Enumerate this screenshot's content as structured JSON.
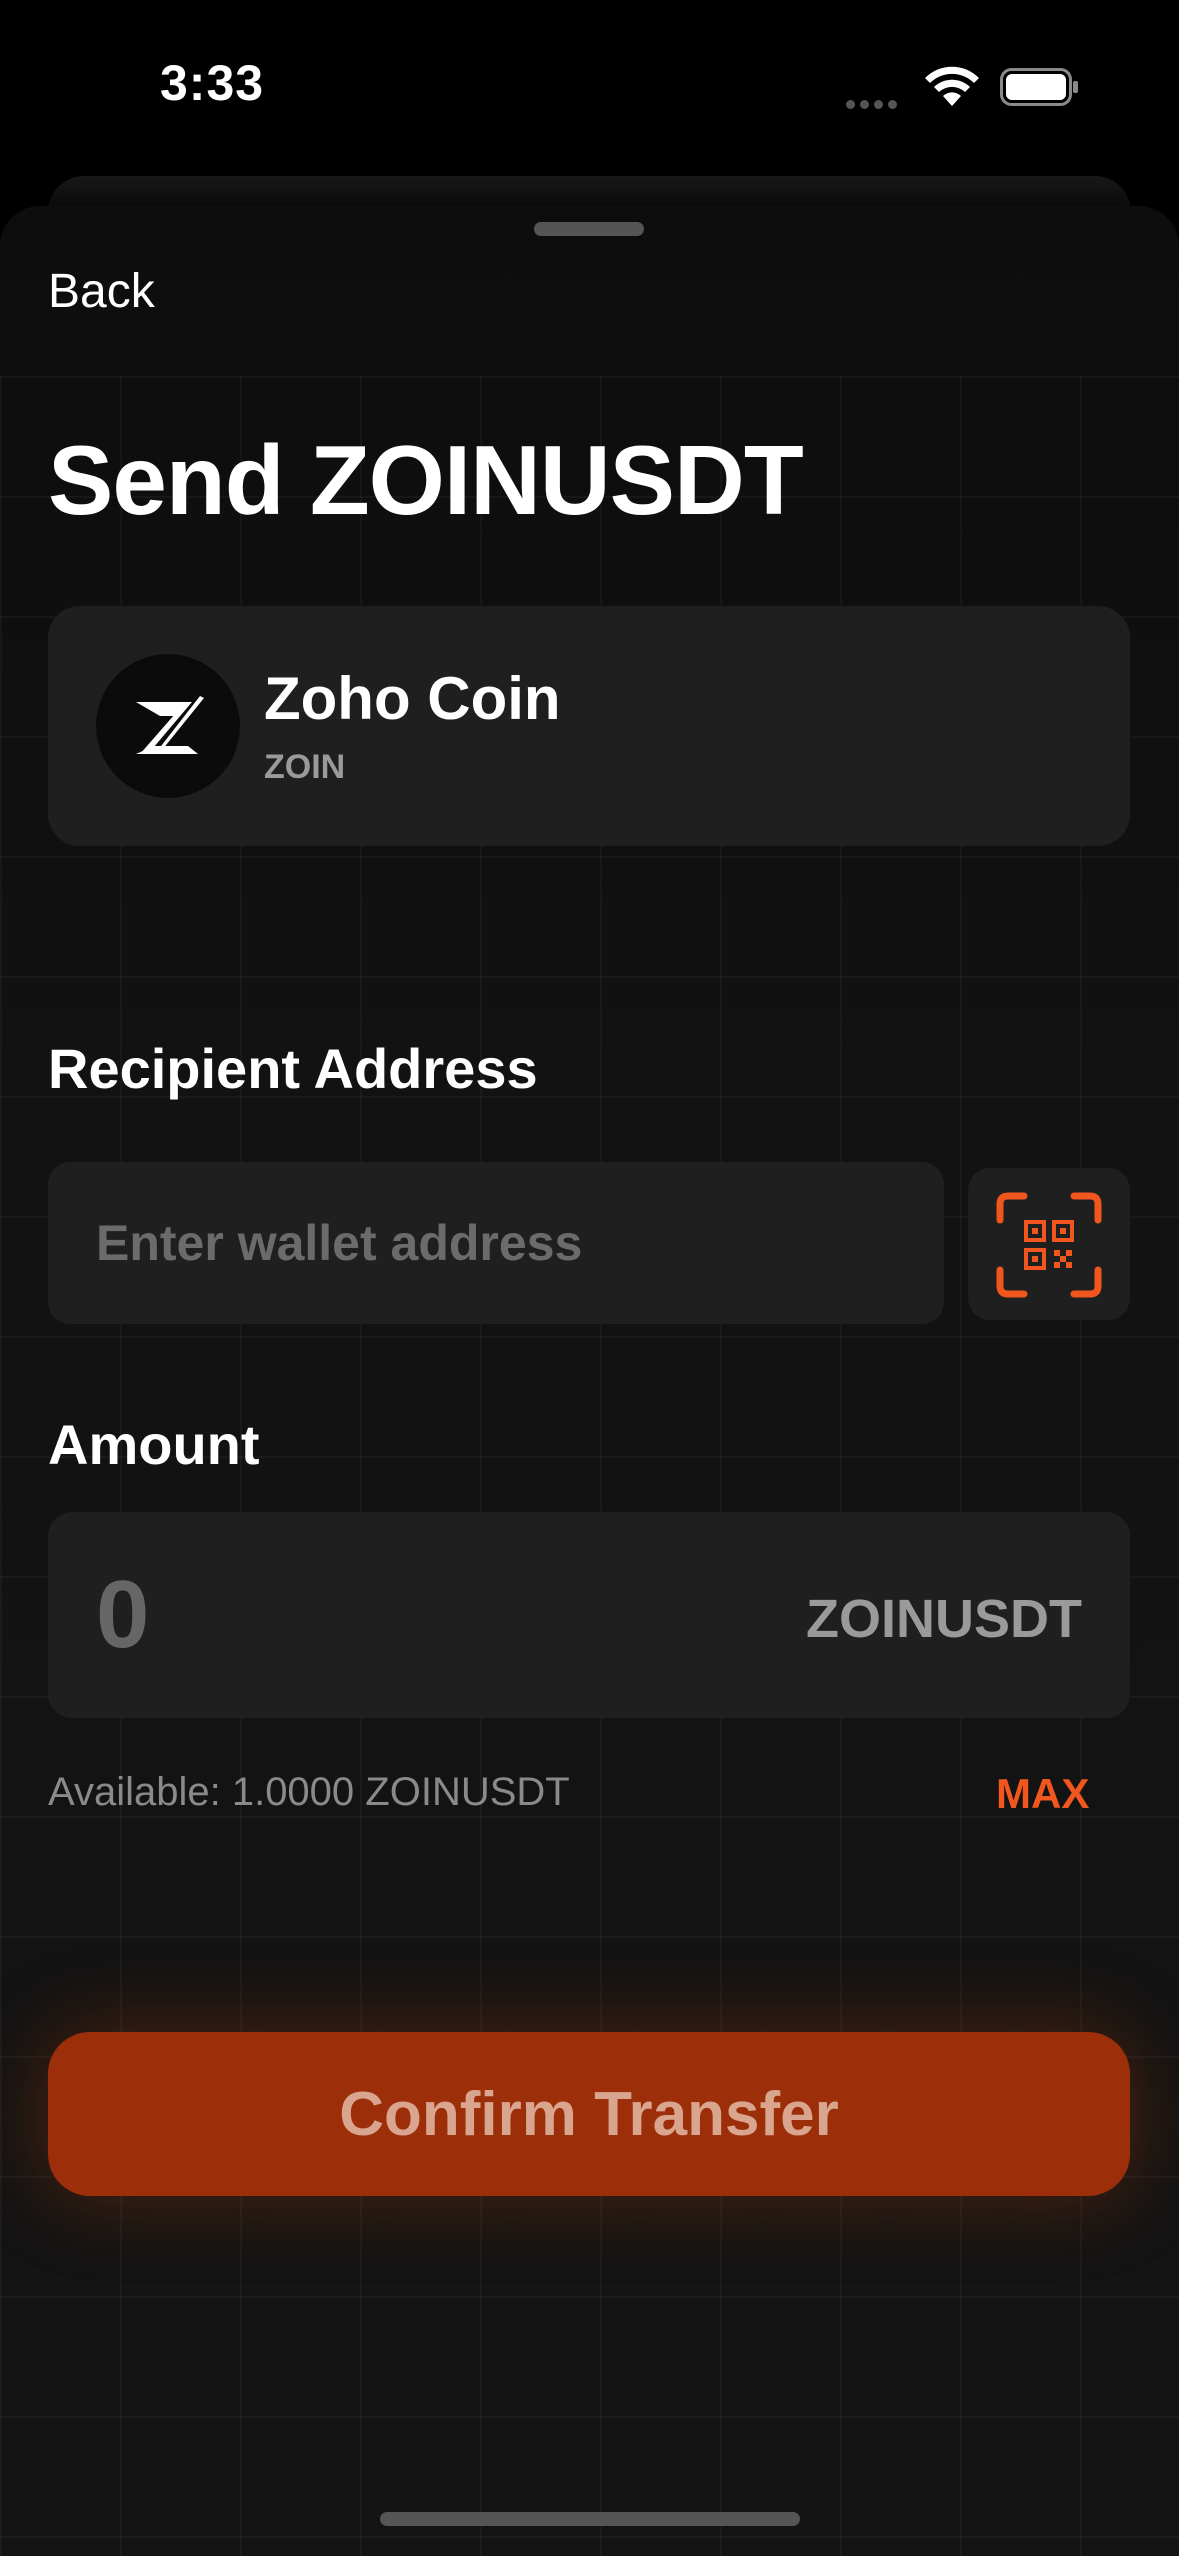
{
  "status_bar": {
    "time": "3:33"
  },
  "nav": {
    "back_label": "Back"
  },
  "page": {
    "title": "Send ZOINUSDT"
  },
  "coin": {
    "name": "Zoho Coin",
    "symbol": "ZOIN",
    "icon": "zoin-logo-icon"
  },
  "recipient": {
    "label": "Recipient Address",
    "placeholder": "Enter wallet address",
    "value": "",
    "scan_icon": "qr-scan-icon"
  },
  "amount": {
    "label": "Amount",
    "value": "0",
    "unit": "ZOINUSDT",
    "available_text": "Available: 1.0000 ZOINUSDT",
    "max_label": "MAX"
  },
  "actions": {
    "confirm_label": "Confirm Transfer"
  },
  "colors": {
    "accent": "#f0561d",
    "confirm_bg": "#9c2e09",
    "card_bg": "#1f1f1f",
    "background": "#000000"
  }
}
